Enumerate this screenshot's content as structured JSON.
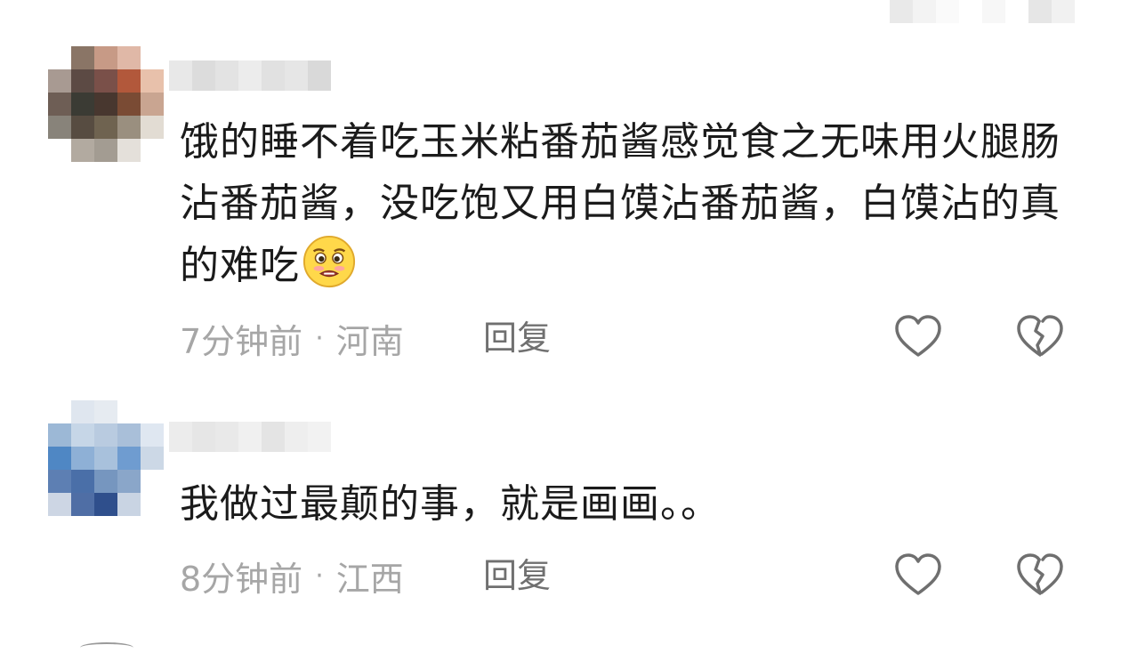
{
  "top_strip": {
    "colors": [
      "#e9e9e9",
      "#f3f3f3",
      "#fafafa",
      "#ffffff",
      "#f7f7f7",
      "#ffffff",
      "#e6e6e6",
      "#f1f1f1"
    ]
  },
  "comments": [
    {
      "avatar_pixels": [
        "#ffffff",
        "#8a7566",
        "#c79a86",
        "#e0b8a7",
        "#ffffff",
        "#a89a92",
        "#5c4a44",
        "#7a5049",
        "#b2583b",
        "#e8c1ab",
        "#6e5e55",
        "#3b3b34",
        "#48372f",
        "#7a4b34",
        "#c9a591",
        "#88837a",
        "#574c41",
        "#6f6350",
        "#9a8f7f",
        "#e2dcd3",
        "#ffffff",
        "#b2aaa0",
        "#a39c92",
        "#e4e0da",
        "#ffffff"
      ],
      "username_pixels": [
        "#e8e8e8",
        "#dcdcdc",
        "#e3e3e3",
        "#ececec",
        "#e1e1e1",
        "#e6e6e6",
        "#d9d9d9"
      ],
      "text": "饿的睡不着吃玉米粘番茄酱感觉食之无味用火腿肠沾番茄酱，没吃饱又用白馍沾番茄酱，白馍沾的真的难吃",
      "emoji": "crying-face-emoji",
      "time": "7分钟前",
      "separator": "·",
      "location": "河南",
      "reply_label": "回复",
      "like_icon": "heart-outline-icon",
      "dislike_icon": "broken-heart-icon"
    },
    {
      "avatar_pixels": [
        "#ffffff",
        "#dfe6ef",
        "#e6ebf1",
        "#ffffff",
        "#ffffff",
        "#9cb8d6",
        "#c6d6e7",
        "#b9cbe0",
        "#a9bfd9",
        "#dfe7f1",
        "#4f87c4",
        "#8eb0d6",
        "#a8c1dc",
        "#6f9cd0",
        "#ccd8e6",
        "#5d7fb3",
        "#4a6fa8",
        "#7696bf",
        "#8aa6c9",
        "#ffffff",
        "#cdd6e4",
        "#4f6ea5",
        "#2f4f8c",
        "#c9d4e3",
        "#ffffff"
      ],
      "username_pixels": [
        "#ececec",
        "#e6e6e6",
        "#e9e9e9",
        "#f0f0f0",
        "#e4e4e4",
        "#eeeeee",
        "#f2f2f2"
      ],
      "text": "我做过最颠的事，就是画画。。",
      "time": "8分钟前",
      "separator": "·",
      "location": "江西",
      "reply_label": "回复",
      "like_icon": "heart-outline-icon",
      "dislike_icon": "broken-heart-icon"
    }
  ]
}
